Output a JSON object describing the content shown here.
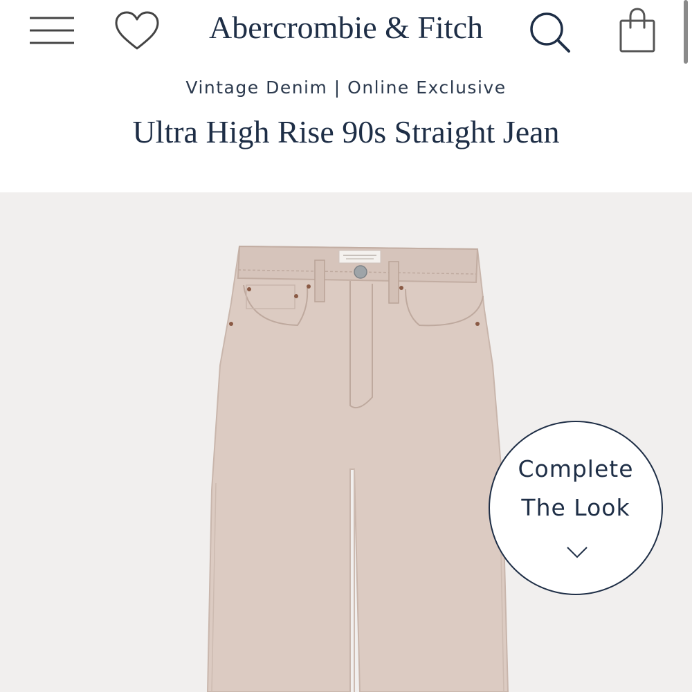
{
  "header": {
    "brand": "Abercrombie & Fitch",
    "icons": {
      "menu": "hamburger-menu-icon",
      "favorites": "heart-icon",
      "search": "search-icon",
      "bag": "shopping-bag-icon"
    }
  },
  "product": {
    "collection": "Vintage Denim | Online Exclusive",
    "title": "Ultra High Rise 90s Straight Jean"
  },
  "complete_the_look": {
    "line1": "Complete",
    "line2": "The Look",
    "icon": "chevron-down-icon"
  },
  "colors": {
    "brand_navy": "#1e2e46",
    "image_bg": "#f1efee",
    "denim_blush": "#dccbc2"
  }
}
